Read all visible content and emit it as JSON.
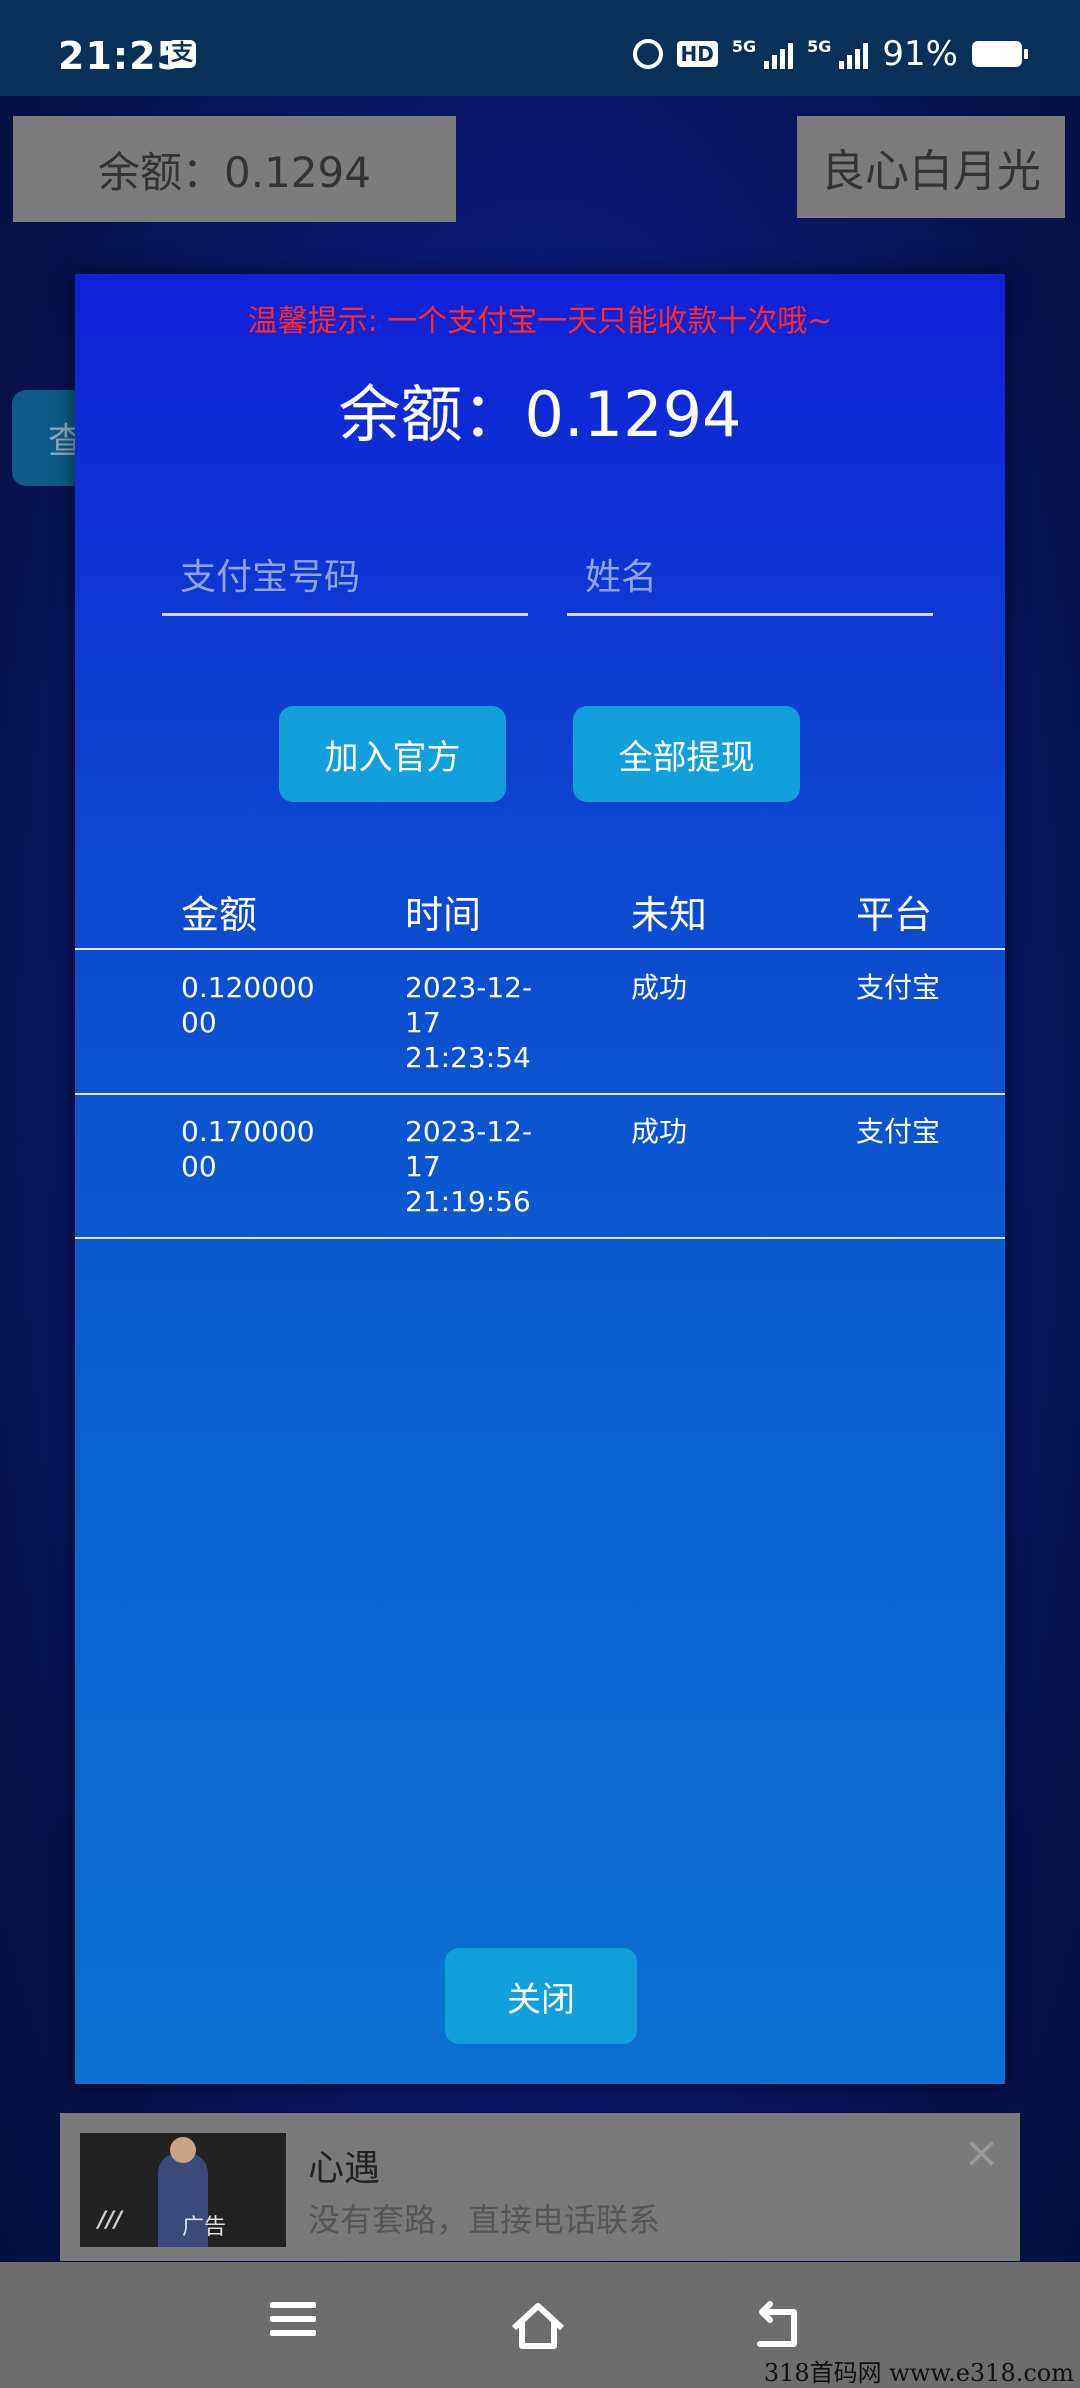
{
  "status_bar": {
    "time": "21:25",
    "app_icon": "支",
    "hd": "HD",
    "net1": "5G",
    "net2": "5G",
    "battery": "91%"
  },
  "background": {
    "balance": "余额：0.1294",
    "name": "良心白月光",
    "left_tab": "查"
  },
  "dialog": {
    "tip": "温馨提示: 一个支付宝一天只能收款十次哦~",
    "balance": "余额：0.1294",
    "alipay_placeholder": "支付宝号码",
    "name_placeholder": "姓名",
    "join_button": "加入官方",
    "withdraw_button": "全部提现",
    "close_button": "关闭",
    "table": {
      "headers": [
        "金额",
        "时间",
        "未知",
        "平台"
      ],
      "rows": [
        {
          "amount": "0.12000000",
          "time": "2023-12-17 21:23:54",
          "status": "成功",
          "platform": "支付宝"
        },
        {
          "amount": "0.17000000",
          "time": "2023-12-17 21:19:56",
          "status": "成功",
          "platform": "支付宝"
        }
      ]
    }
  },
  "ad": {
    "title": "心遇",
    "desc": "没有套路，直接电话联系",
    "tag": "广告",
    "close": "×"
  },
  "watermark": "318首码网  www.e318.com"
}
